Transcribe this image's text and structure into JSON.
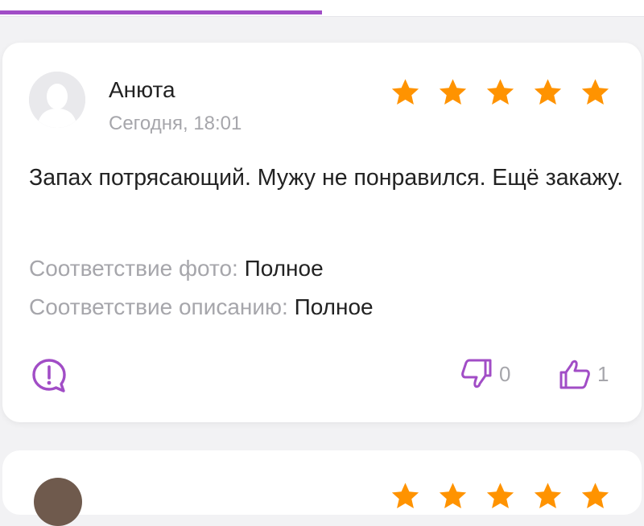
{
  "tabs": {
    "active_indicator_color": "#a14dc6"
  },
  "review": {
    "author": "Анюта",
    "date": "Сегодня, 18:01",
    "rating": 5,
    "rating_max": 5,
    "star_color": "#ff9300",
    "text": "Запах потрясающий. Мужу не понравился. Ещё закажу.",
    "attributes": [
      {
        "label": "Соответствие фото:",
        "value": "Полное"
      },
      {
        "label": "Соответствие описанию:",
        "value": "Полное"
      }
    ],
    "actions": {
      "report_icon": "exclamation-bubble-icon",
      "dislike_icon": "thumbs-down-icon",
      "dislike_count": "0",
      "like_icon": "thumbs-up-icon",
      "like_count": "1",
      "accent_color": "#a14dc6"
    }
  }
}
